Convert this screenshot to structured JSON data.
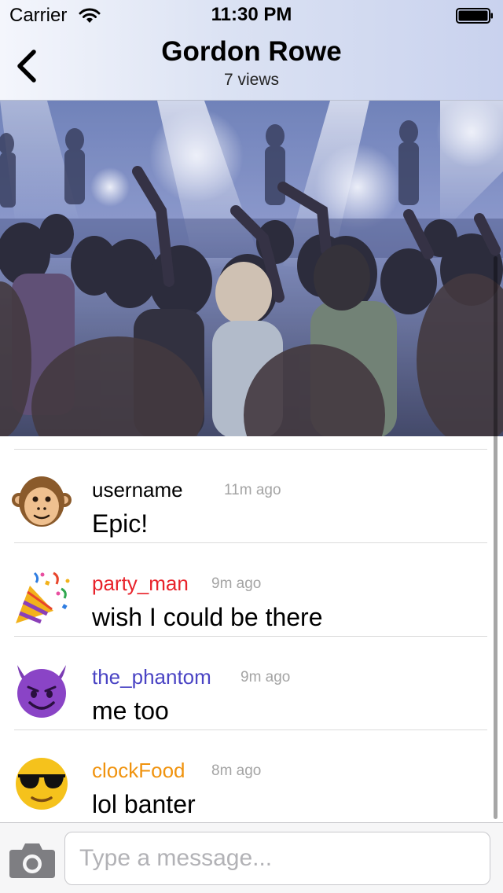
{
  "status_bar": {
    "carrier": "Carrier",
    "time": "11:30 PM"
  },
  "nav": {
    "title": "Gordon Rowe",
    "subtitle": "7 views",
    "back_icon": "chevron-left-icon"
  },
  "photo": {
    "subject": "concert-crowd-photo"
  },
  "comments": [
    {
      "username": "username",
      "time": "11m ago",
      "text": "Epic!",
      "avatar": "monkey-emoji",
      "color": "#000000"
    },
    {
      "username": "party_man",
      "time": "9m ago",
      "text": "wish I could be there",
      "avatar": "party-popper-emoji",
      "color": "#e8232b"
    },
    {
      "username": "the_phantom",
      "time": "9m ago",
      "text": "me too",
      "avatar": "devil-emoji",
      "color": "#4a44c4"
    },
    {
      "username": "clockFood",
      "time": "8m ago",
      "text": "lol banter",
      "avatar": "sunglasses-emoji",
      "color": "#f0930e"
    }
  ],
  "input_bar": {
    "camera_icon": "camera-icon",
    "placeholder": "Type a message...",
    "value": ""
  }
}
